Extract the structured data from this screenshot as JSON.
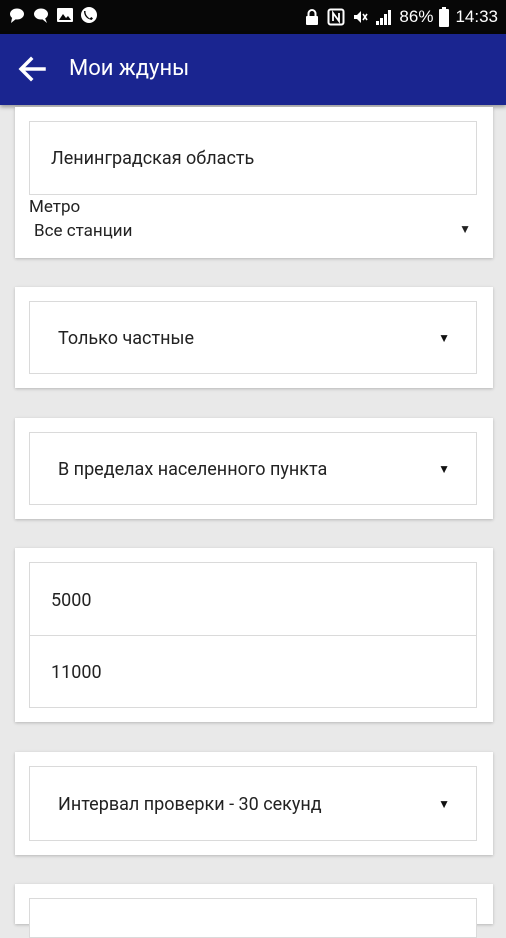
{
  "statusbar": {
    "battery": "86%",
    "time": "14:33"
  },
  "toolbar": {
    "title": "Мои ждуны"
  },
  "location": {
    "region": "Ленинградская область",
    "metro_label": "Метро",
    "metro_value": "Все станции"
  },
  "owner": {
    "value": "Только частные"
  },
  "area": {
    "value": "В пределах населенного пункта"
  },
  "price": {
    "min": "5000",
    "max": "11000"
  },
  "interval": {
    "value": "Интервал проверки - 30 секунд"
  },
  "icons": {
    "back": "arrow-left-icon",
    "dropdown": "triangle-down-icon"
  }
}
